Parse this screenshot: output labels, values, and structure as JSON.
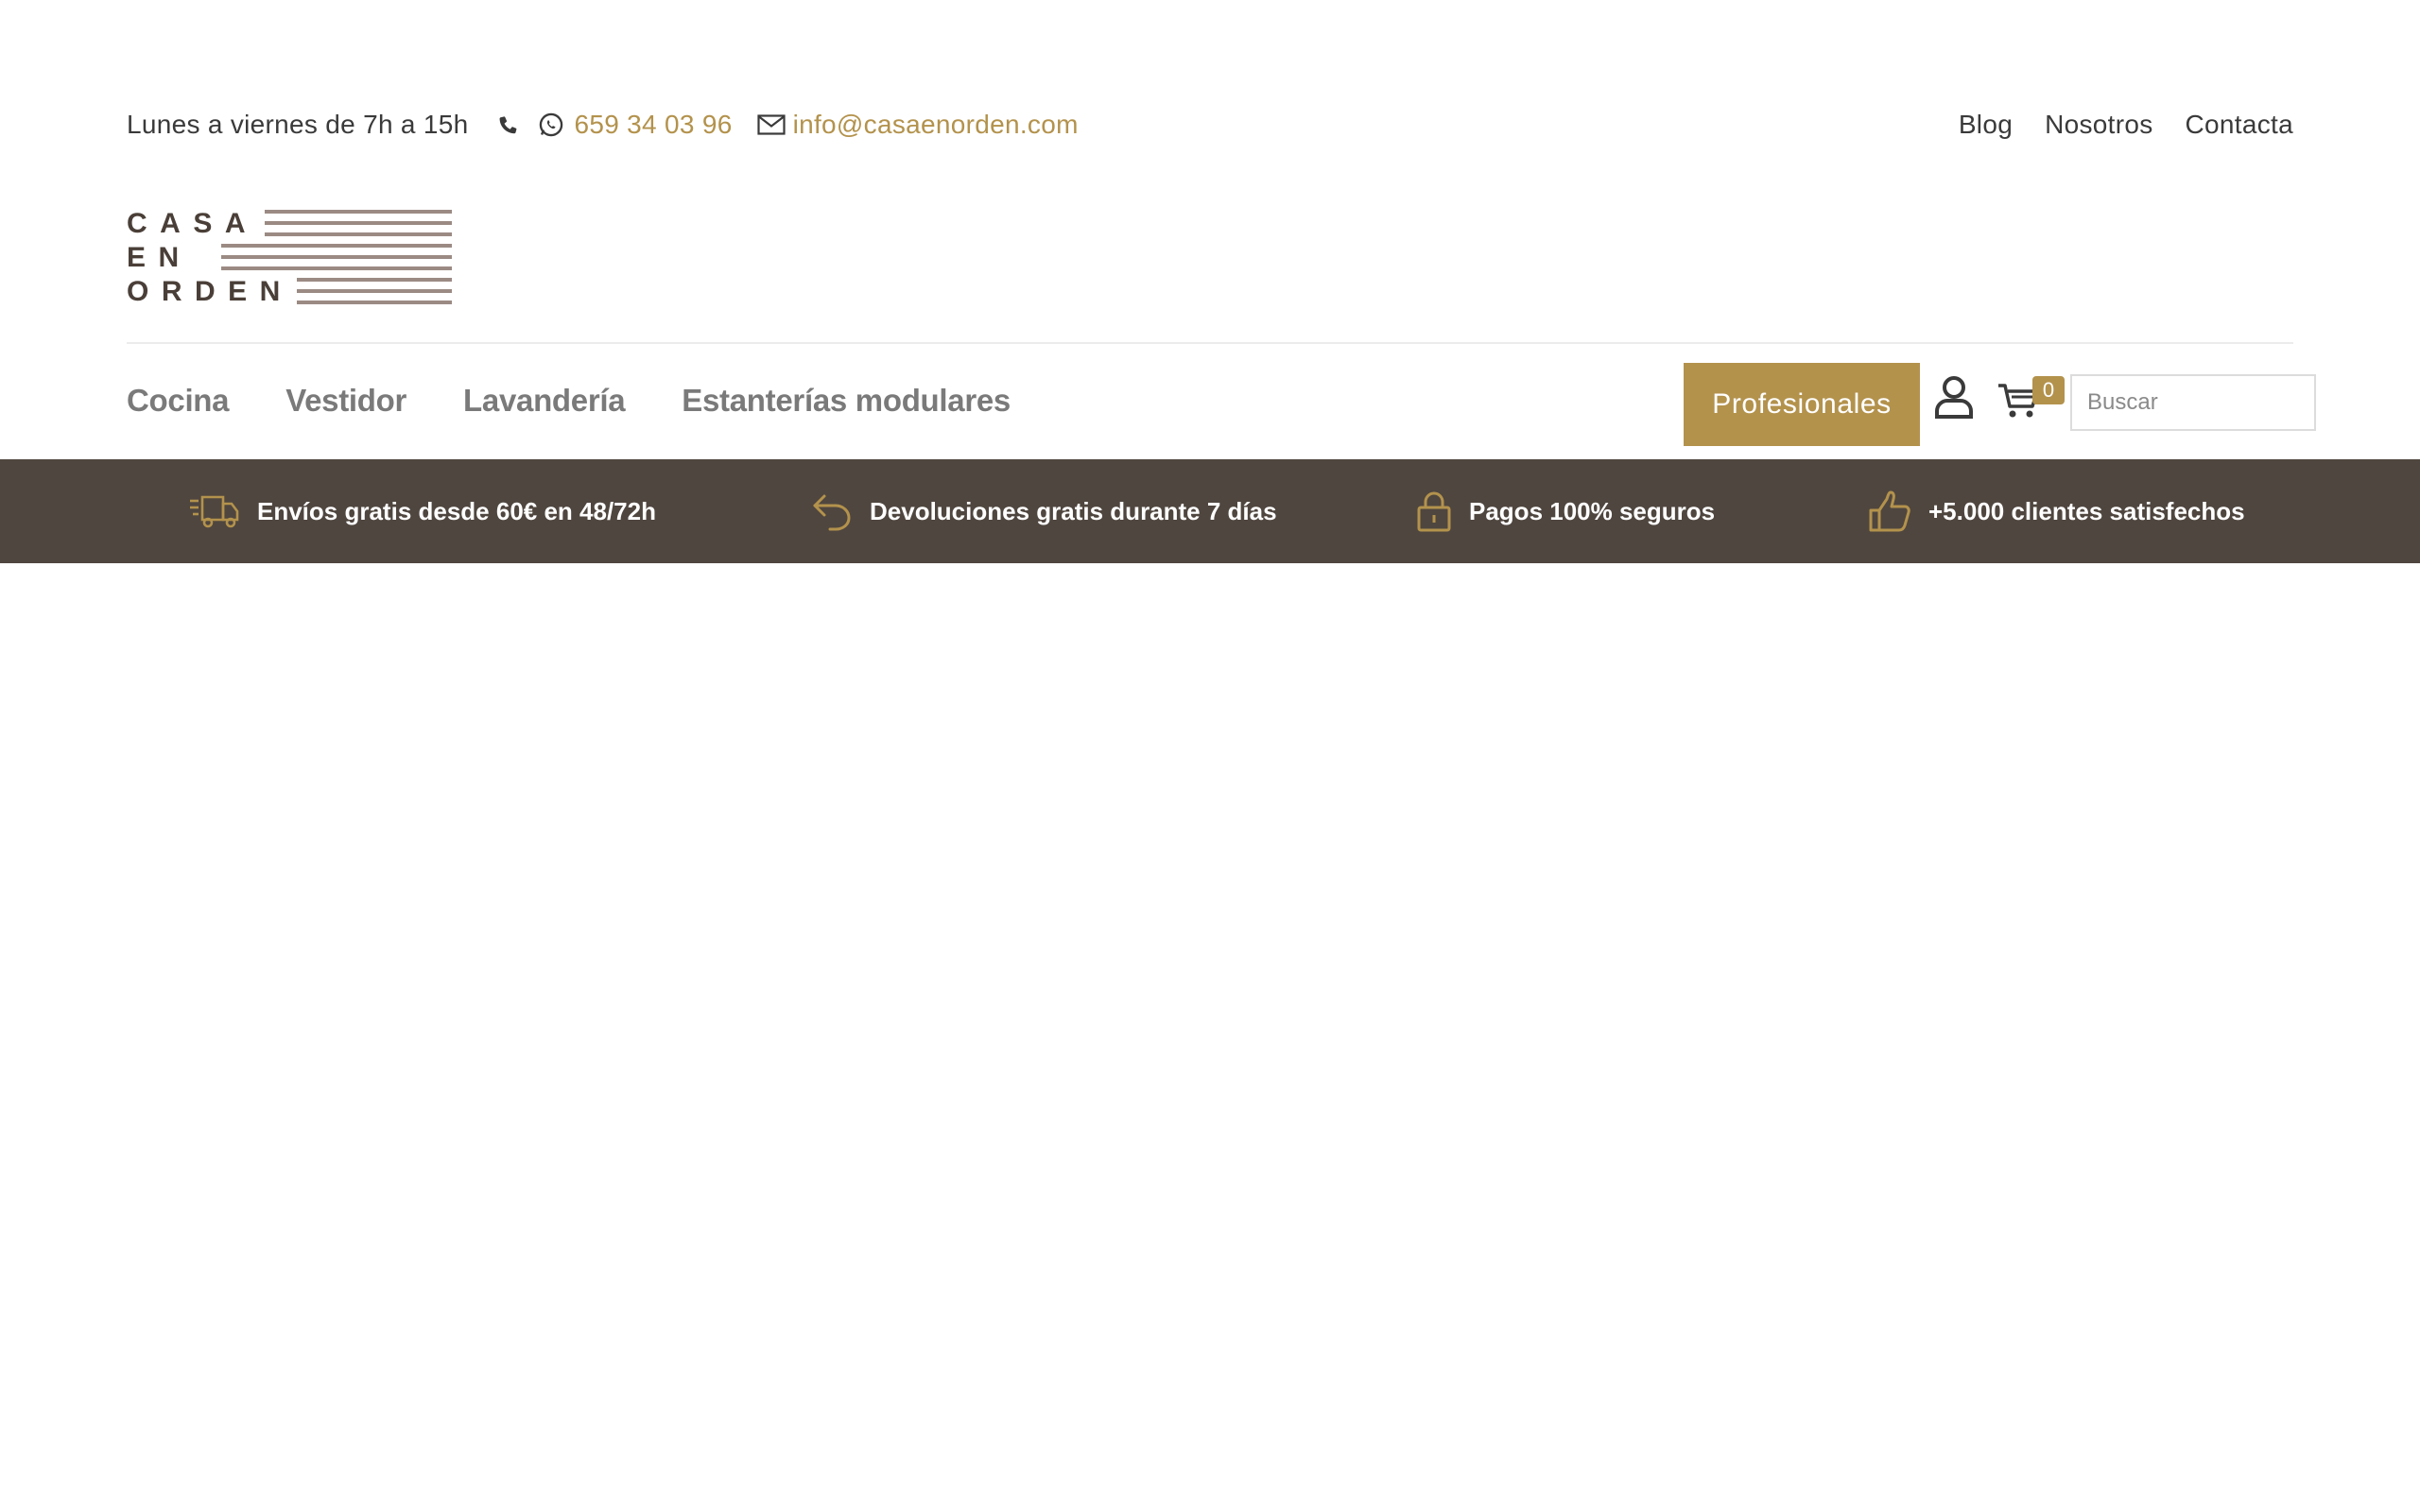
{
  "topbar": {
    "hours": "Lunes a viernes de 7h a 15h",
    "phone": "659 34 03 96",
    "email": "info@casaenorden.com",
    "links": [
      "Blog",
      "Nosotros",
      "Contacta"
    ]
  },
  "logo": {
    "lines": [
      "CASA",
      "EN",
      "ORDEN"
    ]
  },
  "nav": {
    "items": [
      "Cocina",
      "Vestidor",
      "Lavandería",
      "Estanterías modulares"
    ],
    "pro_button": "Profesionales",
    "cart_count": "0",
    "search_placeholder": "Buscar"
  },
  "benefits": [
    {
      "icon": "truck-icon",
      "text": "Envíos gratis desde 60€ en 48/72h"
    },
    {
      "icon": "return-arrow-icon",
      "text": "Devoluciones gratis durante 7 días"
    },
    {
      "icon": "lock-icon",
      "text": "Pagos 100% seguros"
    },
    {
      "icon": "thumbs-up-icon",
      "text": "+5.000 clientes satisfechos"
    }
  ],
  "colors": {
    "accent": "#b3924c",
    "benefits_bg": "#4f463f",
    "logo_lines": "#9b8a84",
    "logo_text": "#4a3f38"
  }
}
